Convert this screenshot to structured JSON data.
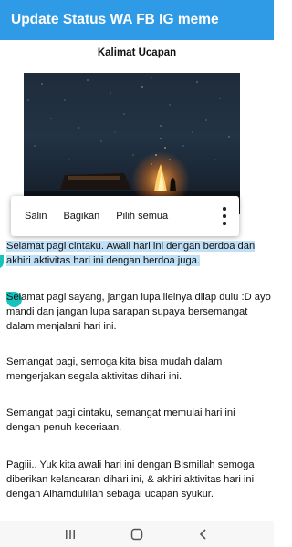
{
  "app_bar": {
    "title": "Update Status WA FB IG meme",
    "color": "#2f9be7"
  },
  "section": {
    "heading": "Kalimat Ucapan"
  },
  "image": {
    "description": "night-campfire-photo"
  },
  "context_menu": {
    "copy_label": "Salin",
    "share_label": "Bagikan",
    "select_all_label": "Pilih semua",
    "more_icon": "more-vert-icon"
  },
  "quotes": [
    "Selamat pagi cintaku. Awali hari ini dengan berdoa dan akhiri aktivitas hari ini dengan berdoa juga.",
    "Selamat pagi sayang, jangan lupa ilelnya dilap dulu :D ayo mandi dan jangan lupa sarapan supaya bersemangat dalam menjalani hari ini.",
    "Semangat pagi, semoga kita bisa mudah dalam mengerjakan segala aktivitas dihari ini.",
    "Semangat pagi cintaku, semangat memulai hari ini dengan penuh keceriaan.",
    "Pagiii.. Yuk kita awali hari ini dengan Bismillah semoga diberikan kelancaran dihari ini, & akhiri aktivitas hari ini dengan Alhamdulillah sebagai ucapan syukur."
  ],
  "selection_color": "#bfe0f6",
  "handle_color": "#19c3bd",
  "nav_bar": {
    "recents_icon": "recents-icon",
    "home_icon": "home-icon",
    "back_icon": "back-icon"
  }
}
